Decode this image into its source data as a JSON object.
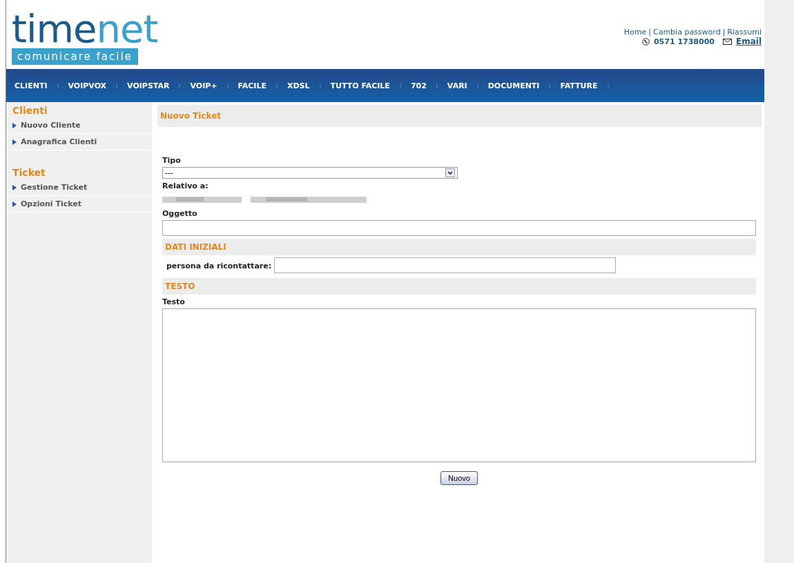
{
  "logo": {
    "name_dark": "time",
    "name_light": "net",
    "tagline": "comunicare facile"
  },
  "top_links": [
    "Home",
    "Cambia password",
    "Riassumi"
  ],
  "link_separator": "|",
  "contact": {
    "phone": "0571 1738000",
    "email": "Email"
  },
  "nav": [
    "CLIENTI",
    "VOIPVOX",
    "VOIPSTAR",
    "VOIP+",
    "FACILE",
    "XDSL",
    "TUTTO FACILE",
    "702",
    "VARI",
    "DOCUMENTI",
    "FATTURE"
  ],
  "sidebar": [
    {
      "title": "Clienti",
      "items": [
        "Nuovo Cliente",
        "Anagrafica Clienti"
      ]
    },
    {
      "title": "Ticket",
      "items": [
        "Gestione Ticket",
        "Opzioni Ticket"
      ]
    }
  ],
  "form": {
    "title": "Nuovo Ticket",
    "tipo": {
      "label": "Tipo",
      "value": "---"
    },
    "relativo": {
      "label": "Relativo a:"
    },
    "oggetto": {
      "label": "Oggetto"
    },
    "dati_iniziali": {
      "heading": "DATI INIZIALI",
      "label": "persona da ricontattare:"
    },
    "testo": {
      "heading": "TESTO",
      "label": "Testo"
    },
    "submit": "Nuovo"
  }
}
